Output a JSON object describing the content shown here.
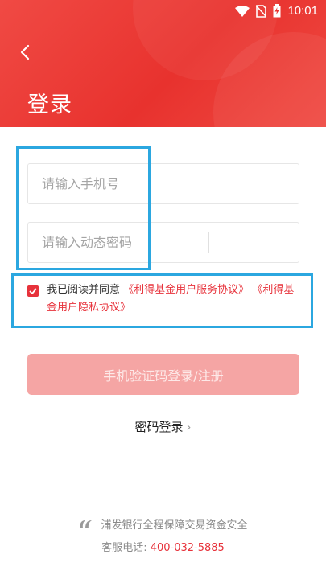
{
  "status": {
    "time": "10:01"
  },
  "header": {
    "title": "登录"
  },
  "form": {
    "phone_placeholder": "请输入手机号",
    "code_placeholder": "请输入动态密码"
  },
  "agreement": {
    "prefix": "我已阅读并同意",
    "link1": "《利得基金用户服务协议》",
    "link2": "《利得基金用户隐私协议》"
  },
  "buttons": {
    "login": "手机验证码登录/注册",
    "password_login": "密码登录"
  },
  "footer": {
    "security_text": "浦发银行全程保障交易资金安全",
    "service_label": "客服电话:",
    "service_phone": "400-032-5885"
  },
  "colors": {
    "brand_red": "#e7323b",
    "highlight": "#2ba7e0"
  },
  "icons": [
    "wifi-icon",
    "no-sim-icon",
    "battery-icon",
    "back-arrow-icon",
    "check-icon",
    "chevron-right-icon",
    "bank-logo-icon"
  ]
}
